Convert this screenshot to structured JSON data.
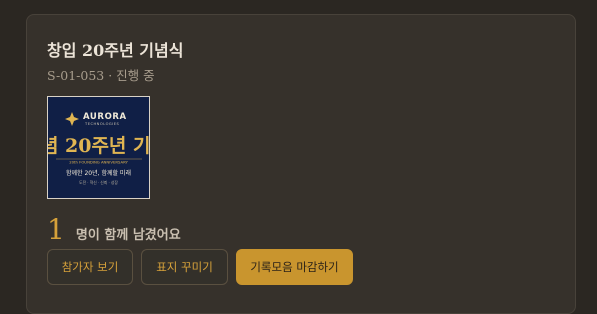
{
  "event": {
    "title": "창입 20주년 기념식",
    "subtitle": "S-01-053 · 진행 중"
  },
  "thumbnail": {
    "brand": "AURORA",
    "brand_sub": "TECHNOLOGIES",
    "headline": "20주년 기",
    "edge_char": "념",
    "tagline": "20th FOUNDING ANNIVERSARY",
    "slogan": "함께한 20년, 함께할 미래",
    "footer": "도전 · 혁신 · 신뢰 · 성장",
    "colors": {
      "background": "#0f1b3d",
      "gold": "#e0b552",
      "text": "#f1ead9"
    }
  },
  "participants": {
    "count": "1",
    "label": "명이 함께 남겼어요"
  },
  "actions": {
    "view_participants": "참가자 보기",
    "decorate_cover": "표지 꾸미기",
    "close_collection": "기록모음 마감하기"
  },
  "colors": {
    "page_bg": "#2b2722",
    "card_bg": "#36312b",
    "accent": "#d6a13a",
    "accent_fill": "#c9952e"
  }
}
